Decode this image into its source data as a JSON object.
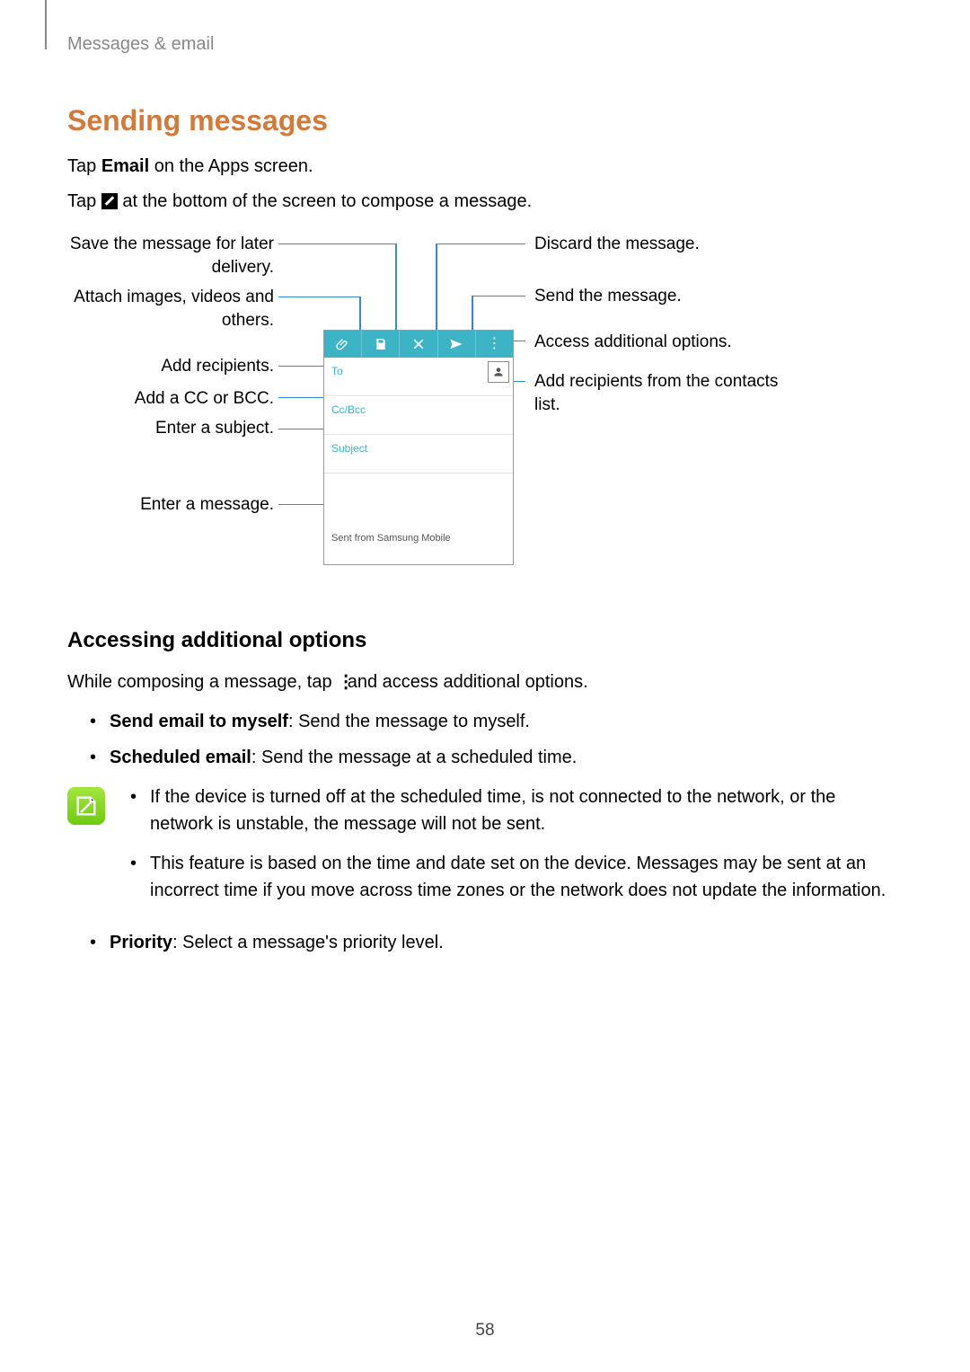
{
  "header": {
    "breadcrumb": "Messages & email"
  },
  "section": {
    "title": "Sending messages",
    "intro1_pre": "Tap ",
    "intro1_bold": "Email",
    "intro1_post": " on the Apps screen.",
    "intro2_pre": "Tap ",
    "intro2_post": " at the bottom of the screen to compose a message."
  },
  "diagram": {
    "left": {
      "save": "Save the message for later delivery.",
      "attach": "Attach images, videos and others.",
      "recipients": "Add recipients.",
      "ccbcc": "Add a CC or BCC.",
      "subject": "Enter a subject.",
      "message": "Enter a message."
    },
    "right": {
      "discard": "Discard the message.",
      "send": "Send the message.",
      "options": "Access additional options.",
      "contacts": "Add recipients from the contacts list."
    },
    "fields": {
      "to": "To",
      "ccbcc": "Cc/Bcc",
      "subject": "Subject",
      "body": "Sent from Samsung Mobile"
    }
  },
  "subsection": {
    "title": "Accessing additional options",
    "intro_pre": "While composing a message, tap ",
    "intro_post": " and access additional options.",
    "opt1_bold": "Send email to myself",
    "opt1_rest": ": Send the message to myself.",
    "opt2_bold": "Scheduled email",
    "opt2_rest": ": Send the message at a scheduled time.",
    "note1": "If the device is turned off at the scheduled time, is not connected to the network, or the network is unstable, the message will not be sent.",
    "note2": "This feature is based on the time and date set on the device. Messages may be sent at an incorrect time if you move across time zones or the network does not update the information.",
    "opt3_bold": "Priority",
    "opt3_rest": ": Select a message's priority level."
  },
  "page_number": "58"
}
